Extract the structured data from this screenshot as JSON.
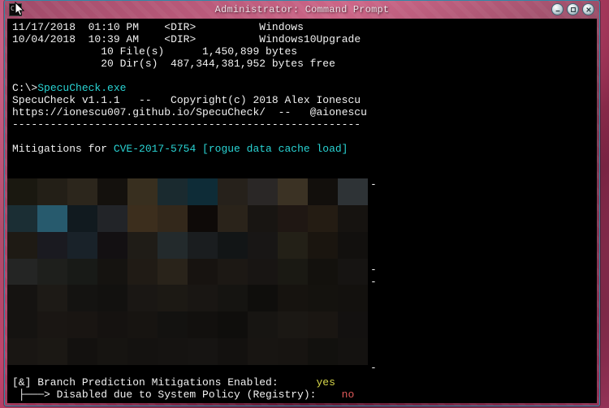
{
  "window": {
    "title": "Administrator: Command Prompt",
    "icon_glyph": "C:\\"
  },
  "dir_listing": {
    "line1_date": "11/17/2018",
    "line1_time": "01:10 PM",
    "line1_kind": "<DIR>",
    "line1_name": "Windows",
    "line2_date": "10/04/2018",
    "line2_time": "10:39 AM",
    "line2_kind": "<DIR>",
    "line2_name": "Windows10Upgrade",
    "files_count": "10 File(s)",
    "files_bytes": "1,450,899 bytes",
    "dirs_count": "20 Dir(s)",
    "dirs_bytes": "487,344,381,952 bytes free"
  },
  "prompt": {
    "path": "C:\\>",
    "command": "SpecuCheck.exe"
  },
  "header": {
    "prog": "SpecuCheck v1.1.1",
    "sep1": "--",
    "copyright": "Copyright(c) 2018 Alex Ionescu",
    "url": "https://ionescu007.github.io/SpecuCheck/",
    "sep2": "--",
    "handle": "@aionescu",
    "rule": "-"
  },
  "mitigations": {
    "prefix": "Mitigations for ",
    "cve": "CVE-2017-5754 [rogue data cache load]"
  },
  "separators": {
    "s1": "-",
    "s2": "-",
    "s3": "-",
    "s4": "-"
  },
  "bottom": {
    "line1_left": "[&] Branch Prediction Mitigations Enabled:",
    "line1_right": "yes",
    "line2_arrow": " ├───> ",
    "line2_text": "Disabled due to System Policy (Registry):",
    "line2_value": " no"
  },
  "colors": {
    "cyan": "#29d3d3",
    "yellow": "#d6d64a",
    "red": "#e05a5a",
    "term_fg": "#f1f1f1",
    "term_bg": "#000000"
  },
  "pixelation_palette": [
    "#1a1810",
    "#231f17",
    "#2c261c",
    "#14110d",
    "#382f1f",
    "#1a2a2f",
    "#0e2c37",
    "#26211b",
    "#2a2726",
    "#3b3224",
    "#120f0c",
    "#2e3336",
    "#1b2e34",
    "#275a6d",
    "#111a1f",
    "#222428",
    "#3c2e1d",
    "#33281b",
    "#0e0a08",
    "#2a231a",
    "#181512",
    "#1f1713",
    "#241c13",
    "#161310",
    "#1e1a14",
    "#1a1a20",
    "#192229",
    "#131012",
    "#1f1c17",
    "#232a2c",
    "#1a1d1f",
    "#121516",
    "#181615",
    "#232017",
    "#1a150f",
    "#12100e",
    "#242524",
    "#1e1f1c",
    "#181a17",
    "#151310",
    "#201b15",
    "#29231a",
    "#171310",
    "#1c1814",
    "#181513",
    "#1a1913",
    "#13110d",
    "#161412",
    "#151311",
    "#1d1a16",
    "#141311",
    "#12110f",
    "#1a1714",
    "#1c1914",
    "#191613",
    "#151411",
    "#0f0e0c",
    "#16130f",
    "#14120e",
    "#13110e",
    "#151311",
    "#1a1613",
    "#191512",
    "#151210",
    "#171411",
    "#131210",
    "#12100e",
    "#0f0e0c",
    "#171512",
    "#1b1814",
    "#1a1612",
    "#131110",
    "#191613",
    "#1b1814",
    "#13110f",
    "#161411",
    "#141210",
    "#151311",
    "#161412",
    "#13110f",
    "#181512",
    "#171411",
    "#12110e",
    "#141210"
  ]
}
